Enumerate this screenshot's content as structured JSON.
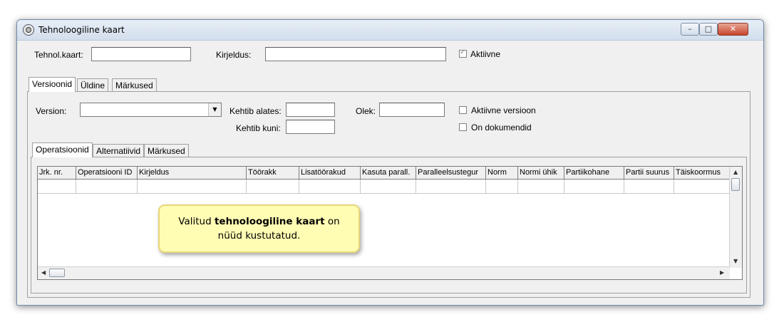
{
  "window": {
    "title": "Tehnoloogiline kaart",
    "buttons": {
      "minimize": "–",
      "maximize": "□",
      "close": "✕"
    }
  },
  "top_form": {
    "tehnol_kaart_label": "Tehnol.kaart:",
    "tehnol_kaart_value": "",
    "kirjeldus_label": "Kirjeldus:",
    "kirjeldus_value": "",
    "aktiivne_label": "Aktiivne",
    "aktiivne_checked": true
  },
  "outer_tabs": [
    "Versioonid",
    "Üldine",
    "Märkused"
  ],
  "version_form": {
    "version_label": "Version:",
    "version_value": "",
    "kehtib_alates_label": "Kehtib alates:",
    "kehtib_alates_value": "",
    "kehtib_kuni_label": "Kehtib kuni:",
    "kehtib_kuni_value": "",
    "olek_label": "Olek:",
    "olek_value": "",
    "aktiivne_versioon_label": "Aktiivne versioon",
    "on_dokumendid_label": "On dokumendid"
  },
  "inner_tabs": [
    "Operatsioonid",
    "Alternatiivid",
    "Märkused"
  ],
  "grid": {
    "columns": [
      "Jrk. nr.",
      "Operatsiooni ID",
      "Kirjeldus",
      "Töörakk",
      "Lisatöörakud",
      "Kasuta parall.",
      "Paralleelsustegur",
      "Norm",
      "Normi ühik",
      "Partiikohane",
      "Partii suurus",
      "Täiskoormus"
    ]
  },
  "tooltip": {
    "text_before": "Valitud ",
    "text_bold": "tehnoloogiline kaart",
    "text_after": " on",
    "line2": "nüüd kustutatud."
  },
  "icons": [
    "app-icon",
    "minimize-icon",
    "maximize-icon",
    "close-icon",
    "dropdown-arrow-icon",
    "scroll-up-icon",
    "scroll-down-icon",
    "scroll-left-icon",
    "scroll-right-icon"
  ],
  "colors": {
    "tooltip_bg": "#fffdb3",
    "tooltip_border": "#e8d67a",
    "close_button": "#c6442d"
  }
}
